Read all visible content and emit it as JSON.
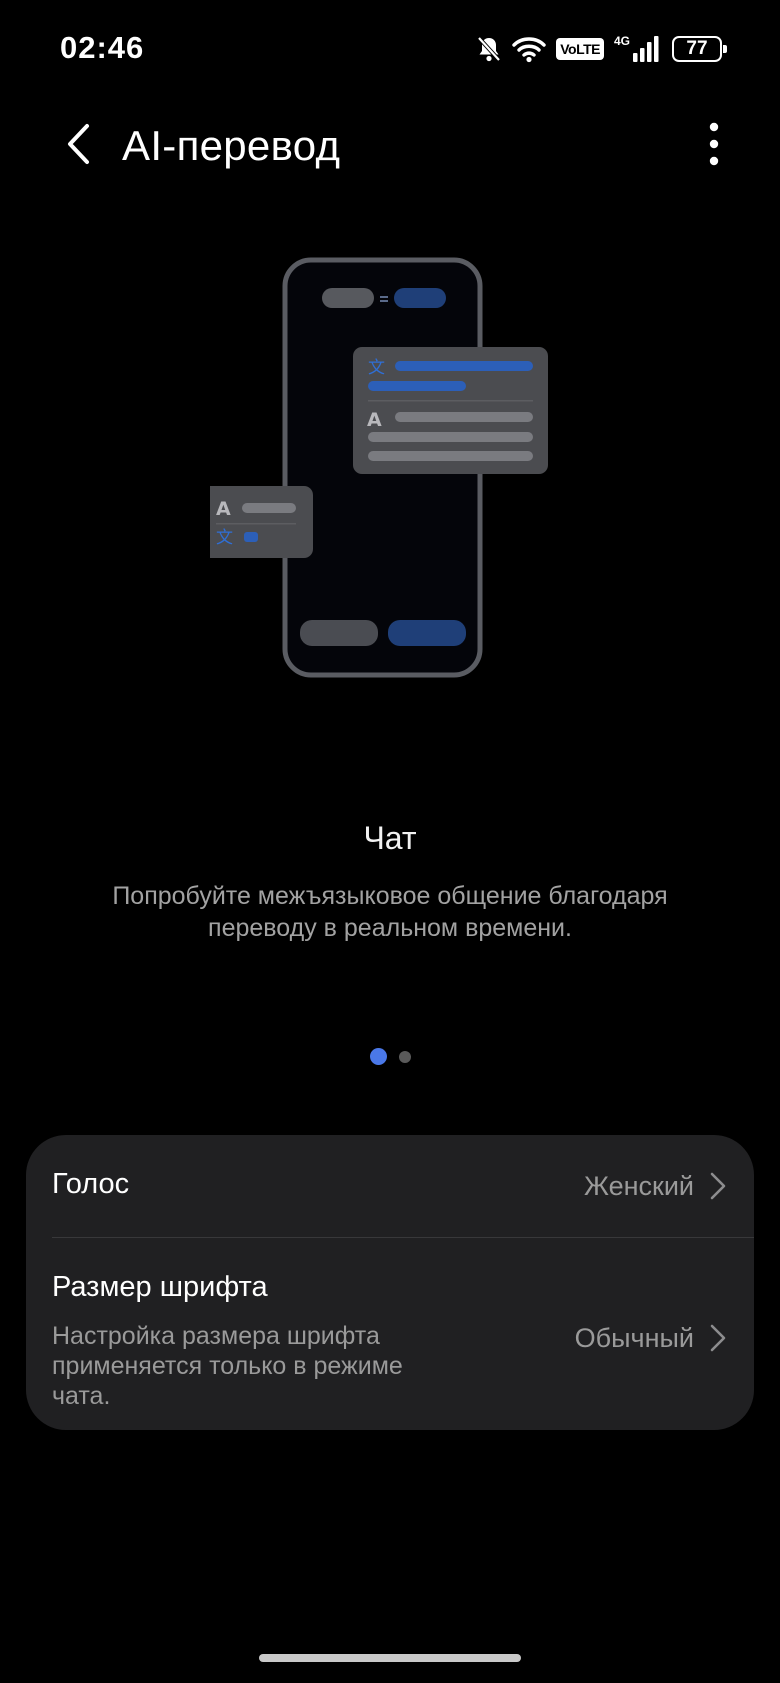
{
  "status_bar": {
    "time": "02:46",
    "volte": "VoLTE",
    "network": "4G",
    "battery": "77",
    "icons": [
      "bell-muted-icon",
      "wifi-icon",
      "volte-icon",
      "signal-icon",
      "battery-icon"
    ]
  },
  "header": {
    "title": "AI-перевод",
    "back_icon": "chevron-left-icon",
    "more_icon": "more-vertical-icon"
  },
  "illustration": {
    "glyph_translate": "文",
    "glyph_latin": "A",
    "accent_color": "#2f6fd6"
  },
  "carousel": {
    "title": "Чат",
    "description": "Попробуйте межъязыковое общение благодаря переводу в реальном времени.",
    "page_count": 2,
    "active_page": 1,
    "active_color": "#4a78e8"
  },
  "settings": {
    "voice": {
      "label": "Голос",
      "value": "Женский"
    },
    "font_size": {
      "label": "Размер шрифта",
      "description": "Настройка размера шрифта применяется только в режиме чата.",
      "value": "Обычный"
    }
  }
}
